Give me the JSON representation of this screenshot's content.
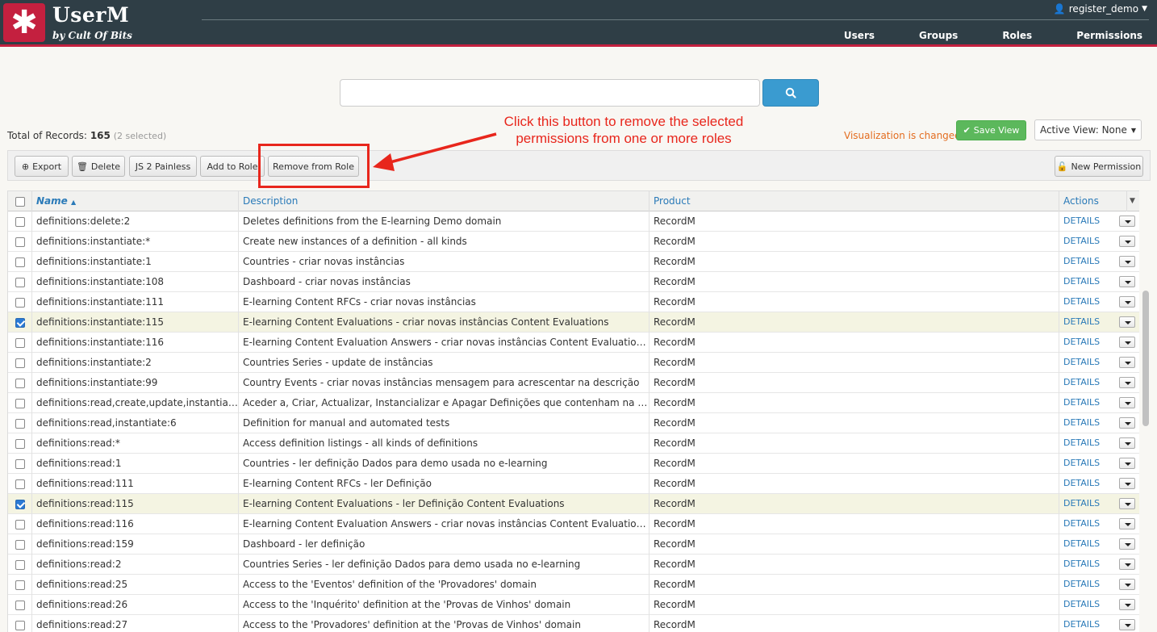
{
  "app": {
    "brand": "UserM",
    "tagline": "by Cult Of Bits",
    "logo_glyph": "✱",
    "user": "register_demo",
    "accent": "#c4203f"
  },
  "nav": [
    {
      "label": "Users"
    },
    {
      "label": "Groups"
    },
    {
      "label": "Roles"
    },
    {
      "label": "Permissions"
    }
  ],
  "search": {
    "value": "",
    "placeholder": ""
  },
  "summary": {
    "total_label": "Total of Records:",
    "total": "165",
    "selected": "(2 selected)",
    "viz_changed": "Visualization is changed",
    "save_view": "Save View",
    "active_view": "Active View: None"
  },
  "annotation": {
    "text": "Click this button to remove the selected permissions from one or more roles"
  },
  "toolbar": {
    "export": "Export",
    "delete": "Delete",
    "js2painless": "JS 2 Painless",
    "add_to_role": "Add to Role",
    "remove_from_role": "Remove from Role",
    "new_permission": "New Permission"
  },
  "table": {
    "headers": {
      "name": "Name",
      "description": "Description",
      "product": "Product",
      "actions": "Actions"
    },
    "details_label": "DETAILS",
    "rows": [
      {
        "name": "definitions:delete:2",
        "description": "Deletes definitions from the E-learning Demo domain",
        "product": "RecordM",
        "checked": false
      },
      {
        "name": "definitions:instantiate:*",
        "description": "Create new instances of a definition - all kinds",
        "product": "RecordM",
        "checked": false
      },
      {
        "name": "definitions:instantiate:1",
        "description": "Countries - criar novas instâncias",
        "product": "RecordM",
        "checked": false
      },
      {
        "name": "definitions:instantiate:108",
        "description": "Dashboard - criar novas instâncias",
        "product": "RecordM",
        "checked": false
      },
      {
        "name": "definitions:instantiate:111",
        "description": "E-learning Content RFCs - criar novas instâncias",
        "product": "RecordM",
        "checked": false
      },
      {
        "name": "definitions:instantiate:115",
        "description": "E-learning Content Evaluations - criar novas instâncias Content Evaluations",
        "product": "RecordM",
        "checked": true
      },
      {
        "name": "definitions:instantiate:116",
        "description": "E-learning Content Evaluation Answers - criar novas instâncias Content Evaluations Answers",
        "product": "RecordM",
        "checked": false
      },
      {
        "name": "definitions:instantiate:2",
        "description": "Countries Series - update de instâncias",
        "product": "RecordM",
        "checked": false
      },
      {
        "name": "definitions:instantiate:99",
        "description": "Country Events - criar novas instâncias mensagem para acrescentar na descrição",
        "product": "RecordM",
        "checked": false
      },
      {
        "name": "definitions:read,create,update,instantiate,...",
        "description": "Aceder a, Criar, Actualizar, Instancializar e Apagar Definições que contenham na descrição ...",
        "product": "RecordM",
        "checked": false
      },
      {
        "name": "definitions:read,instantiate:6",
        "description": "Definition for manual and automated tests",
        "product": "RecordM",
        "checked": false
      },
      {
        "name": "definitions:read:*",
        "description": "Access definition listings - all kinds of definitions",
        "product": "RecordM",
        "checked": false
      },
      {
        "name": "definitions:read:1",
        "description": "Countries - ler definição Dados para demo usada no e-learning",
        "product": "RecordM",
        "checked": false
      },
      {
        "name": "definitions:read:111",
        "description": "E-learning Content RFCs - ler Definição",
        "product": "RecordM",
        "checked": false
      },
      {
        "name": "definitions:read:115",
        "description": "E-learning Content Evaluations - ler Definição Content Evaluations",
        "product": "RecordM",
        "checked": true
      },
      {
        "name": "definitions:read:116",
        "description": "E-learning Content Evaluation Answers - criar novas instâncias Content Evaluations Answers",
        "product": "RecordM",
        "checked": false
      },
      {
        "name": "definitions:read:159",
        "description": "Dashboard - ler definição",
        "product": "RecordM",
        "checked": false
      },
      {
        "name": "definitions:read:2",
        "description": "Countries Series - ler definição Dados para demo usada no e-learning",
        "product": "RecordM",
        "checked": false
      },
      {
        "name": "definitions:read:25",
        "description": "Access to the 'Eventos' definition of the 'Provadores' domain",
        "product": "RecordM",
        "checked": false
      },
      {
        "name": "definitions:read:26",
        "description": "Access to the 'Inquérito' definition at the 'Provas de Vinhos' domain",
        "product": "RecordM",
        "checked": false
      },
      {
        "name": "definitions:read:27",
        "description": "Access to the 'Provadores' definition at the 'Provas de Vinhos' domain",
        "product": "RecordM",
        "checked": false
      }
    ]
  }
}
